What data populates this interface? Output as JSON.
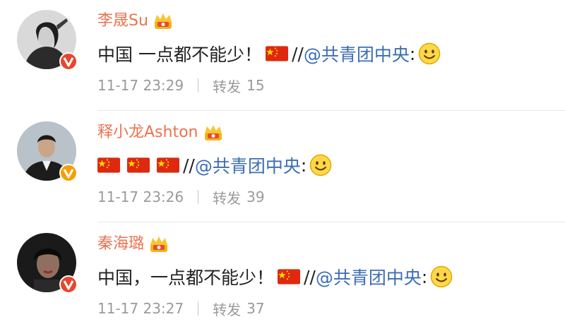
{
  "posts": [
    {
      "username": "李晟Su",
      "text_before": "中国 一点都不能少！",
      "flag_count": 1,
      "repost_prefix": "//",
      "mention": "@共青团中央",
      "colon": ":",
      "timestamp": "11-17 23:29",
      "repost_label": "转发",
      "repost_count": "15",
      "badge_color": "#e8462e"
    },
    {
      "username": "释小龙Ashton",
      "text_before": "",
      "flag_count": 3,
      "repost_prefix": "//",
      "mention": "@共青团中央",
      "colon": ":",
      "timestamp": "11-17 23:26",
      "repost_label": "转发",
      "repost_count": "39",
      "badge_color": "#f59f00"
    },
    {
      "username": "秦海璐",
      "text_before": "中国，一点都不能少！",
      "flag_count": 1,
      "repost_prefix": "//",
      "mention": "@共青团中央",
      "colon": ":",
      "timestamp": "11-17 23:27",
      "repost_label": "转发",
      "repost_count": "37",
      "badge_color": "#e8462e"
    }
  ],
  "colors": {
    "username": "#eb7350",
    "mention": "#3d6eb5",
    "meta": "#9a9a9a",
    "text": "#222222"
  },
  "icons": {
    "crown": "vip-crown-icon",
    "flag": "china-flag-icon",
    "emoji": "smile-emoji-icon",
    "verified": "verified-v-icon"
  }
}
